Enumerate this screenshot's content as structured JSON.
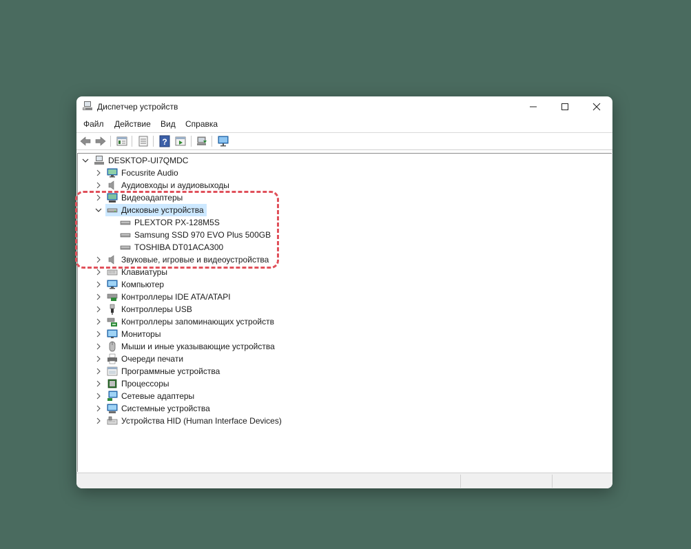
{
  "window": {
    "title": "Диспетчер устройств"
  },
  "menu": [
    "Файл",
    "Действие",
    "Вид",
    "Справка"
  ],
  "toolbar": {
    "icons": [
      "back-arrow-icon",
      "forward-arrow-icon",
      "properties-sheet-icon",
      "list-view-icon",
      "help-icon",
      "run-driver-icon",
      "update-driver-icon",
      "monitor-scan-icon"
    ]
  },
  "tree": {
    "root": "DESKTOP-UI7QMDC",
    "categories": [
      {
        "label": "Focusrite Audio",
        "icon": "audio-monitor-icon",
        "expanded": false
      },
      {
        "label": "Аудиовходы и аудиовыходы",
        "icon": "speaker-icon",
        "expanded": false
      },
      {
        "label": "Видеоадаптеры",
        "icon": "display-adapter-icon",
        "expanded": false
      },
      {
        "label": "Дисковые устройства",
        "icon": "disk-drive-icon",
        "expanded": true,
        "selected": true,
        "children": [
          "PLEXTOR PX-128M5S",
          "Samsung SSD 970 EVO Plus 500GB",
          "TOSHIBA DT01ACA300"
        ]
      },
      {
        "label": "Звуковые, игровые и видеоустройства",
        "icon": "speaker-icon",
        "expanded": false
      },
      {
        "label": "Клавиатуры",
        "icon": "keyboard-icon",
        "expanded": false
      },
      {
        "label": "Компьютер",
        "icon": "computer-icon",
        "expanded": false
      },
      {
        "label": "Контроллеры IDE ATA/ATAPI",
        "icon": "ide-controller-icon",
        "expanded": false
      },
      {
        "label": "Контроллеры USB",
        "icon": "usb-icon",
        "expanded": false
      },
      {
        "label": "Контроллеры запоминающих устройств",
        "icon": "storage-controller-icon",
        "expanded": false
      },
      {
        "label": "Мониторы",
        "icon": "monitor-icon",
        "expanded": false
      },
      {
        "label": "Мыши и иные указывающие устройства",
        "icon": "mouse-icon",
        "expanded": false
      },
      {
        "label": "Очереди печати",
        "icon": "printer-icon",
        "expanded": false
      },
      {
        "label": "Программные устройства",
        "icon": "software-device-icon",
        "expanded": false
      },
      {
        "label": "Процессоры",
        "icon": "processor-icon",
        "expanded": false
      },
      {
        "label": "Сетевые адаптеры",
        "icon": "network-adapter-icon",
        "expanded": false
      },
      {
        "label": "Системные устройства",
        "icon": "system-device-icon",
        "expanded": false
      },
      {
        "label": "Устройства HID (Human Interface Devices)",
        "icon": "hid-icon",
        "expanded": false
      }
    ]
  },
  "colors": {
    "background": "#4a6b5f",
    "selection": "#cce8ff",
    "highlight_annotation": "#e0505a"
  }
}
